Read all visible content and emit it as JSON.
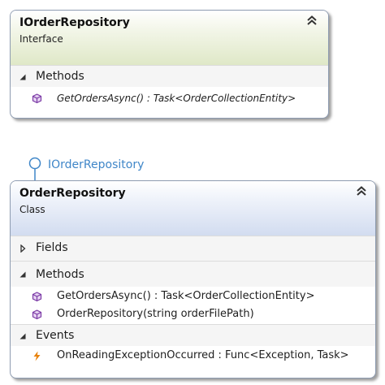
{
  "interface_box": {
    "title": "IOrderRepository",
    "kind": "Interface",
    "collapse_icon": "double-chevron-up-icon",
    "sections": {
      "methods": {
        "label": "Methods",
        "expanded": true,
        "items": [
          {
            "text": "GetOrdersAsync() : Task<OrderCollectionEntity>",
            "icon": "method-cube-icon"
          }
        ]
      }
    }
  },
  "implements": {
    "label": "IOrderRepository",
    "color": "#3f86c8"
  },
  "class_box": {
    "title": "OrderRepository",
    "kind": "Class",
    "collapse_icon": "double-chevron-up-icon",
    "sections": {
      "fields": {
        "label": "Fields",
        "expanded": false
      },
      "methods": {
        "label": "Methods",
        "expanded": true,
        "items": [
          {
            "text": "GetOrdersAsync() : Task<OrderCollectionEntity>",
            "icon": "method-cube-icon"
          },
          {
            "text": "OrderRepository(string orderFilePath)",
            "icon": "method-cube-icon"
          }
        ]
      },
      "events": {
        "label": "Events",
        "expanded": true,
        "items": [
          {
            "text": "OnReadingExceptionOccurred : Func<Exception, Task>",
            "icon": "event-lightning-icon"
          }
        ]
      }
    }
  },
  "colors": {
    "method_icon": "#7b3aa5",
    "event_icon": "#e8830d",
    "interface_header": "#dfe8c7",
    "class_header": "#d2dcf0",
    "border": "#8e9cb1"
  }
}
